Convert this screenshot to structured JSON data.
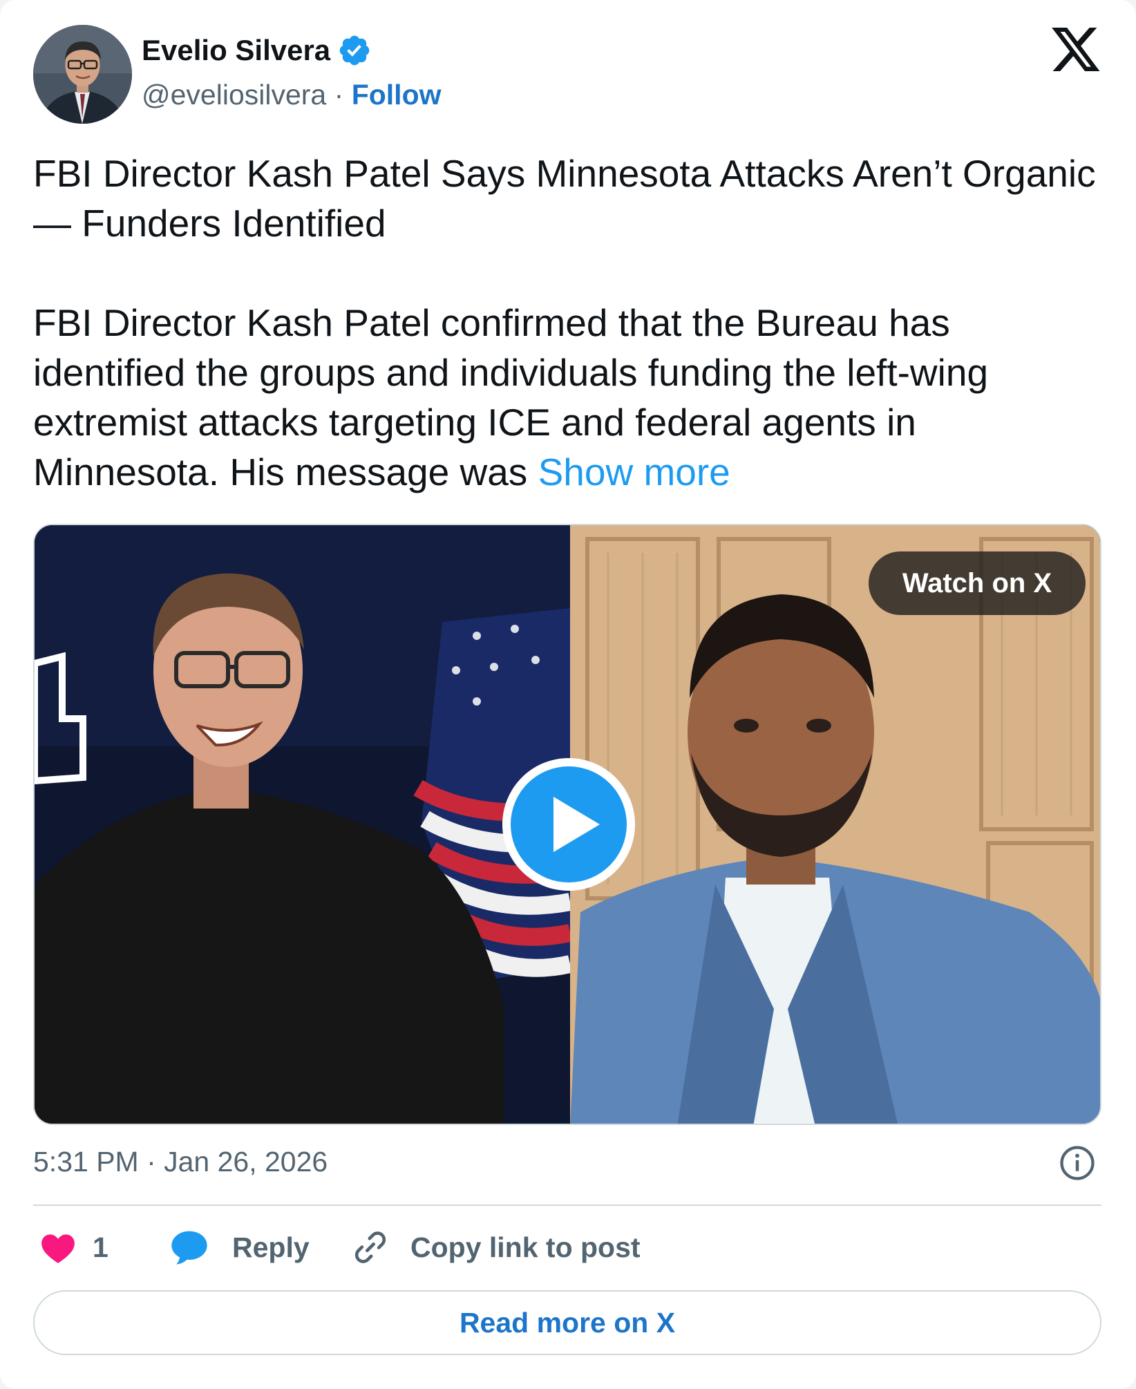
{
  "author": {
    "display_name": "Evelio Silvera",
    "handle": "@eveliosilvera",
    "separator": "·",
    "follow_label": "Follow",
    "verified_icon": "verified-badge-icon",
    "verified_color": "#1d9bf0"
  },
  "tweet": {
    "headline": "FBI Director Kash Patel Says Minnesota Attacks Aren’t Organic — Funders Identified",
    "body": "FBI Director Kash Patel confirmed that the Bureau has identified the groups and individuals funding the left-wing extremist attacks targeting ICE and federal agents in Minnesota. His message was",
    "show_more_label": "Show more"
  },
  "media": {
    "watch_label": "Watch on X",
    "play_icon": "play-icon"
  },
  "timestamp": "5:31 PM · Jan 26, 2026",
  "actions": {
    "like_count": "1",
    "reply_label": "Reply",
    "copy_link_label": "Copy link to post"
  },
  "read_more_label": "Read more on X",
  "colors": {
    "accent": "#1d9bf0",
    "link": "#1d75c9",
    "like": "#f91880",
    "muted_text": "#536471",
    "border": "#cfd9de"
  }
}
